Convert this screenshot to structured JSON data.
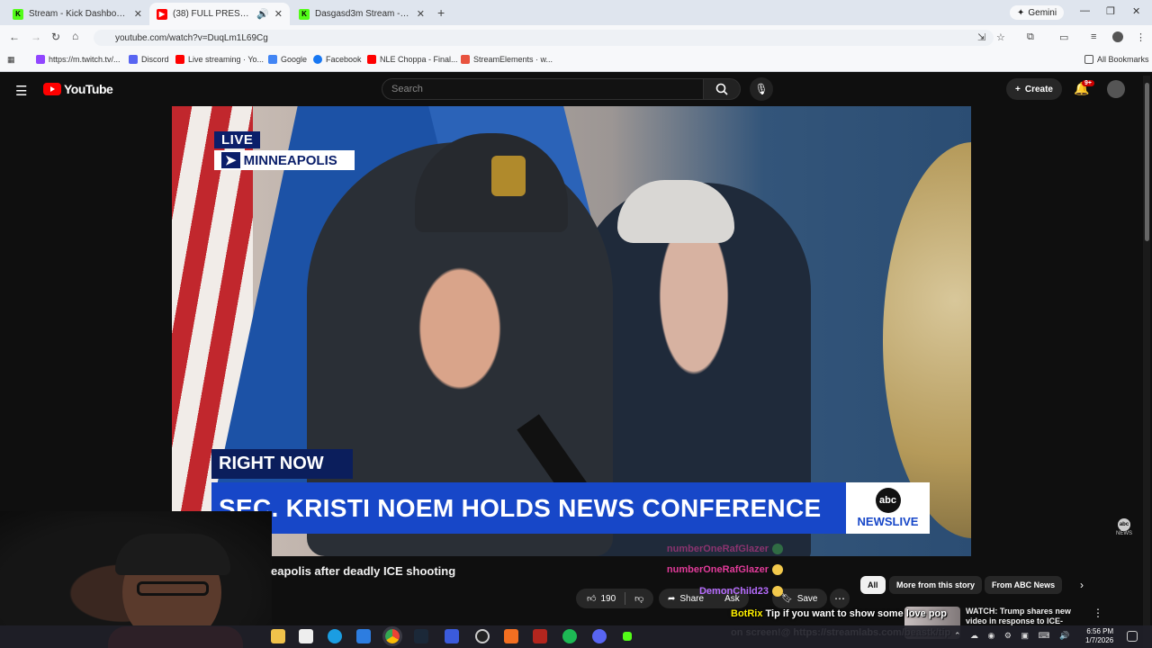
{
  "browser": {
    "tabs": [
      {
        "title": "Stream - Kick Dashboard",
        "icon": "kick-icon",
        "color": "#53fc18"
      },
      {
        "title": "(38) FULL PRESS CONFERE...",
        "icon": "youtube-icon",
        "color": "#ff0000"
      },
      {
        "title": "Dasgasd3m Stream - Watch Li...",
        "icon": "kick-icon",
        "color": "#53fc18"
      }
    ],
    "gemini_label": "Gemini",
    "url": "youtube.com/watch?v=DuqLm1L69Cg",
    "bookmarks": [
      {
        "label": "https://m.twitch.tv/...",
        "color": "#9146ff"
      },
      {
        "label": "Discord",
        "color": "#5865f2"
      },
      {
        "label": "Live streaming · Yo...",
        "color": "#ff0000"
      },
      {
        "label": "Google",
        "color": "#4285f4"
      },
      {
        "label": "Facebook",
        "color": "#1877f2"
      },
      {
        "label": "NLE Choppa - Final...",
        "color": "#ff0000"
      },
      {
        "label": "StreamElements · w...",
        "color": "#e8533f"
      }
    ],
    "all_bookmarks_label": "All Bookmarks"
  },
  "youtube": {
    "logo_text": "YouTube",
    "search_placeholder": "Search",
    "create_label": "Create",
    "notification_count": "9+"
  },
  "video": {
    "live_tag": "LIVE",
    "location": "MINNEAPOLIS",
    "location_arrow": "➤",
    "right_now": "RIGHT NOW",
    "headline": "SEC. KRISTI NOEM HOLDS NEWS CONFERENCE",
    "network_logo": "abc",
    "network_label": "NEWSLIVE",
    "watermark": "NEWS"
  },
  "below_video": {
    "title": "eapolis after deadly ICE shooting",
    "like_count": "190",
    "share_label": "Share",
    "ask_label": "Ask",
    "save_label": "Save"
  },
  "chat": [
    {
      "user": "numberOneRafGlazer",
      "color": "#e23b9a"
    },
    {
      "user": "numberOneRafGlazer",
      "color": "#e23b9a"
    },
    {
      "user": "DemonChild23",
      "color": "#b76cff"
    }
  ],
  "tip_overlay": {
    "bot_name": "BotRix",
    "message": "Tip if you want to show some love pop on screen!@ https://streamlabs.com/beastk/tip"
  },
  "chips": [
    "All",
    "More from this story",
    "From ABC News"
  ],
  "recommendation": {
    "title": "WATCH: Trump shares new video in response to ICE-"
  },
  "taskbar": {
    "time": "6:56 PM",
    "date": "1/7/2026"
  }
}
